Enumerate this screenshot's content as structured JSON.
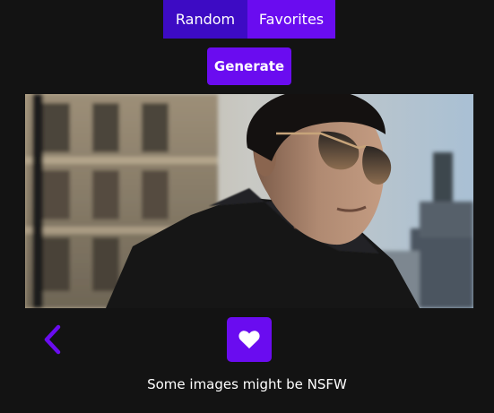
{
  "tabs": {
    "random_label": "Random",
    "favorites_label": "Favorites"
  },
  "actions": {
    "generate_label": "Generate"
  },
  "image": {
    "alt": "Man in black coat and aviator sunglasses on a city street"
  },
  "footer": {
    "notice": "Some images might be NSFW"
  },
  "icons": {
    "back": "chevron-left-icon",
    "favorite": "heart-icon"
  },
  "colors": {
    "background": "#131313",
    "tab_active": "#3d0bc4",
    "accent": "#6a0cf0",
    "text": "#ffffff"
  }
}
